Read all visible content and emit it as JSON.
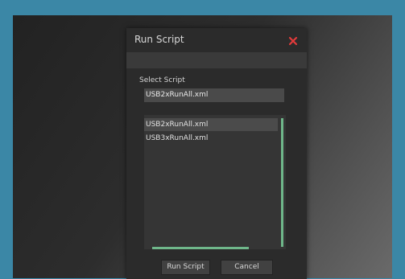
{
  "dialog": {
    "title": "Run Script",
    "select_label": "Select Script",
    "selected_value": "USB2xRunAll.xml",
    "list_items": [
      "USB2xRunAll.xml",
      "USB3xRunAll.xml"
    ],
    "run_button_label": "Run Script",
    "cancel_button_label": "Cancel"
  },
  "colors": {
    "desktop_bg": "#3b87a6",
    "close_x": "#e23b3b",
    "scroll_accent": "#6fb78a"
  }
}
